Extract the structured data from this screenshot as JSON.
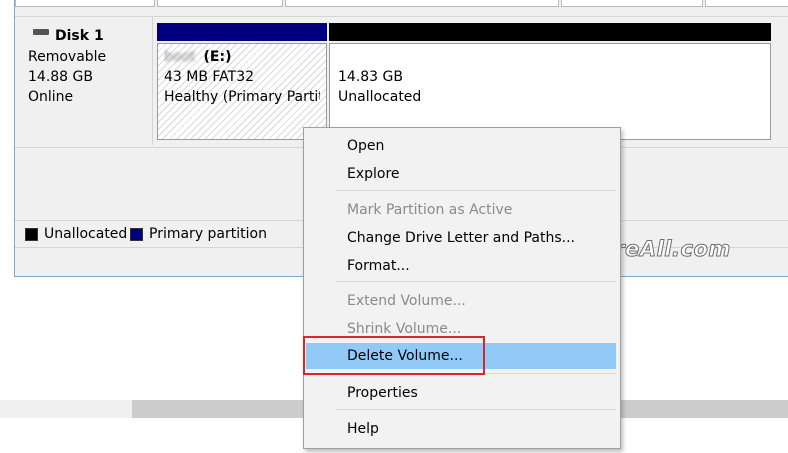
{
  "disk": {
    "name": "Disk 1",
    "type": "Removable",
    "size": "14.88 GB",
    "status": "Online"
  },
  "partitions": [
    {
      "label_blurred": "boot",
      "drive": "(E:)",
      "size_fs": "43 MB FAT32",
      "status": "Healthy (Primary Partiti",
      "bar_color": "#00007f"
    },
    {
      "size": "14.83 GB",
      "status": "Unallocated",
      "bar_color": "#000000"
    }
  ],
  "legend": [
    {
      "label": "Unallocated",
      "color": "#000000"
    },
    {
      "label": "Primary partition",
      "color": "#00007f"
    }
  ],
  "context_menu": {
    "items": [
      {
        "label": "Open",
        "enabled": true
      },
      {
        "label": "Explore",
        "enabled": true
      },
      {
        "label": "Mark Partition as Active",
        "enabled": false
      },
      {
        "label": "Change Drive Letter and Paths...",
        "enabled": true
      },
      {
        "label": "Format...",
        "enabled": true
      },
      {
        "label": "Extend Volume...",
        "enabled": false
      },
      {
        "label": "Shrink Volume...",
        "enabled": false
      },
      {
        "label": "Delete Volume...",
        "enabled": true,
        "highlighted": true
      },
      {
        "label": "Properties",
        "enabled": true
      },
      {
        "label": "Help",
        "enabled": true
      }
    ],
    "hover_color": "#91c9f7",
    "annotation_color": "#d8262c"
  },
  "watermark": {
    "text": "iCareAll.com"
  }
}
